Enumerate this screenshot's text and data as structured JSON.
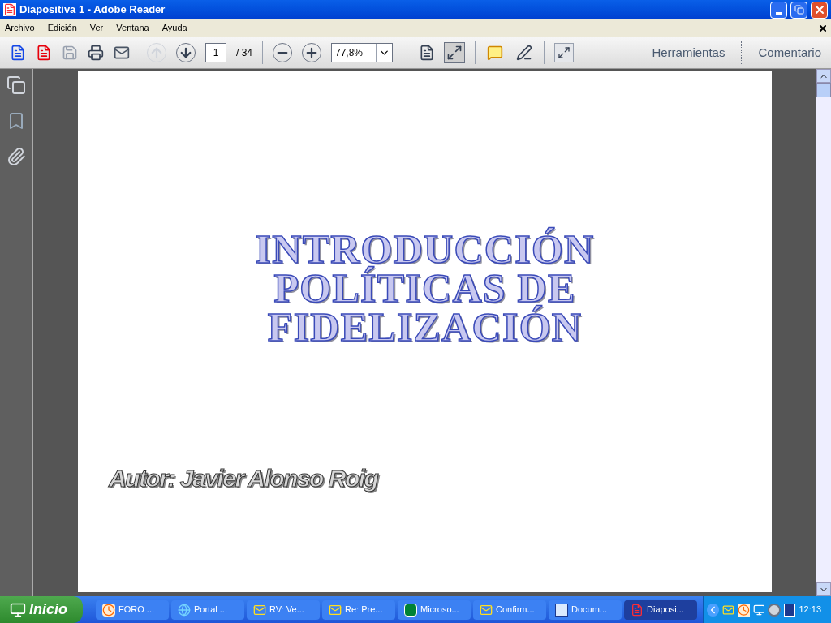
{
  "window": {
    "title": "Diapositiva 1 - Adobe Reader"
  },
  "menu": [
    "Archivo",
    "Edición",
    "Ver",
    "Ventana",
    "Ayuda"
  ],
  "toolbar": {
    "page_number": "1",
    "page_total": "/ 34",
    "zoom": "77,8%",
    "view_buttons": [
      {
        "kind": "fit-width",
        "selected": false
      },
      {
        "kind": "fit-page",
        "selected": true
      }
    ],
    "panels": [
      "Herramientas",
      "Comentario"
    ]
  },
  "slide": {
    "title_lines": [
      "INTRODUCCIÓN",
      "POLÍTICAS DE",
      "FIDELIZACIÓN"
    ],
    "author": "Autor: Javier Alonso Roig"
  },
  "taskbar": {
    "start": "Inicio",
    "tasks": [
      {
        "kind": "clock",
        "label": "FORO ...",
        "selected": false
      },
      {
        "kind": "browser",
        "label": "Portal ...",
        "selected": false
      },
      {
        "kind": "mail",
        "label": "RV: Ve...",
        "selected": false
      },
      {
        "kind": "mail",
        "label": "Re: Pre...",
        "selected": false
      },
      {
        "kind": "sheet",
        "label": "Microso...",
        "selected": false
      },
      {
        "kind": "mail",
        "label": "Confirm...",
        "selected": false
      },
      {
        "kind": "doc",
        "label": "Docum...",
        "selected": false
      },
      {
        "kind": "pdf",
        "label": "Diaposi...",
        "selected": true
      }
    ],
    "clock": "12:13"
  }
}
